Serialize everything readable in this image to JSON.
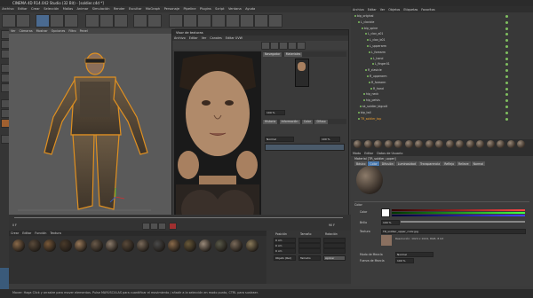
{
  "window": {
    "title": "CINEMA 4D R14.042 Studio (32 Bit) - [soldier.c4d *]"
  },
  "menu": [
    "Archivo",
    "Editar",
    "Crear",
    "Selección",
    "Mallas",
    "Animar",
    "Simulación",
    "Render",
    "Escultar",
    "MoGraph",
    "Personaje",
    "Pipeline",
    "Plugins",
    "Script",
    "Ventana",
    "Ayuda"
  ],
  "viewport": {
    "menu": [
      "Ver",
      "Cámaras",
      "Mostrar",
      "Opciones",
      "Filtro",
      "Panel"
    ]
  },
  "texture_window": {
    "title": "Visor de texturas",
    "menu": [
      "Archivo",
      "Editar",
      "Ver",
      "Canales",
      "Editar UVW"
    ],
    "tabs": [
      "Navegador",
      "Materiales"
    ],
    "tabs2": [
      "Historia",
      "Información",
      "Color",
      "Difuso",
      "Luminoso"
    ],
    "layer_label": "Normal",
    "opacity": "100 %",
    "zoom": "100 %",
    "status": "Tamaño 1024x1024, RGB (8 Bit), sRGB IEC61966-2.1"
  },
  "object_manager": {
    "menu": [
      "Archivo",
      "Editar",
      "Ver",
      "Objetos",
      "Etiquetas",
      "Favoritos"
    ],
    "rows": [
      "bip_original",
      "L_clavicle",
      "bip_spine",
      "L_clav_a01",
      "L_clav_b01",
      "L_upperarm",
      "L_forearm",
      "L_hand",
      "L_finger01",
      "R_clavicle",
      "R_upperarm",
      "R_forearm",
      "R_hand",
      "hip_neck",
      "hip_pelvis",
      "sk_soldier_bigcolt",
      "bip_tail",
      "TR_soldier_top"
    ]
  },
  "attributes": {
    "menu": [
      "Modo",
      "Editar",
      "Datos de Usuario"
    ],
    "material_name": "Material [TR_soldier_upper]",
    "tabs": [
      "Básico",
      "Color",
      "Difusión",
      "Luminosidad",
      "Transparencia",
      "Reflejo",
      "Relieve",
      "Normal"
    ],
    "section": "Color",
    "color_label": "Color",
    "brightness_label": "Brillo",
    "brightness_value": "100 %",
    "texture_label": "Textura",
    "texture_file": "TR_soldier_upper_color.jpg",
    "mix_label": "Modo de Mezcla",
    "mix_value": "Normal",
    "mix_strength_label": "Fuerza de Mezcla",
    "mix_strength_value": "100 %",
    "resolution": "Resolución: 1024 x 1024, RGB, 8 bit"
  },
  "timeline": {
    "frame_start": "0 F",
    "frame_end": "90 F"
  },
  "material_bar": {
    "menu": [
      "Crear",
      "Editar",
      "Función",
      "Textura"
    ]
  },
  "coords": {
    "labels": [
      "Posición",
      "Tamaño",
      "Rotación"
    ],
    "x_pos": "0 cm",
    "y_pos": "0 cm",
    "z_pos": "0 cm",
    "mode": "Objeto (Rel)",
    "mode2": "Tamaño",
    "apply": "Aplicar"
  },
  "statusbar": {
    "text": "Mover: Haga Click y arrastre para mover elementos. Pulse MAYÚSCULAS para cuantificar el movimiento / añadir a la selección en modo punto, CTRL para sustraer."
  },
  "colors": {
    "accent": "#4a7ab0",
    "orange_outline": "#e09020",
    "green": "#7fbf5f"
  }
}
